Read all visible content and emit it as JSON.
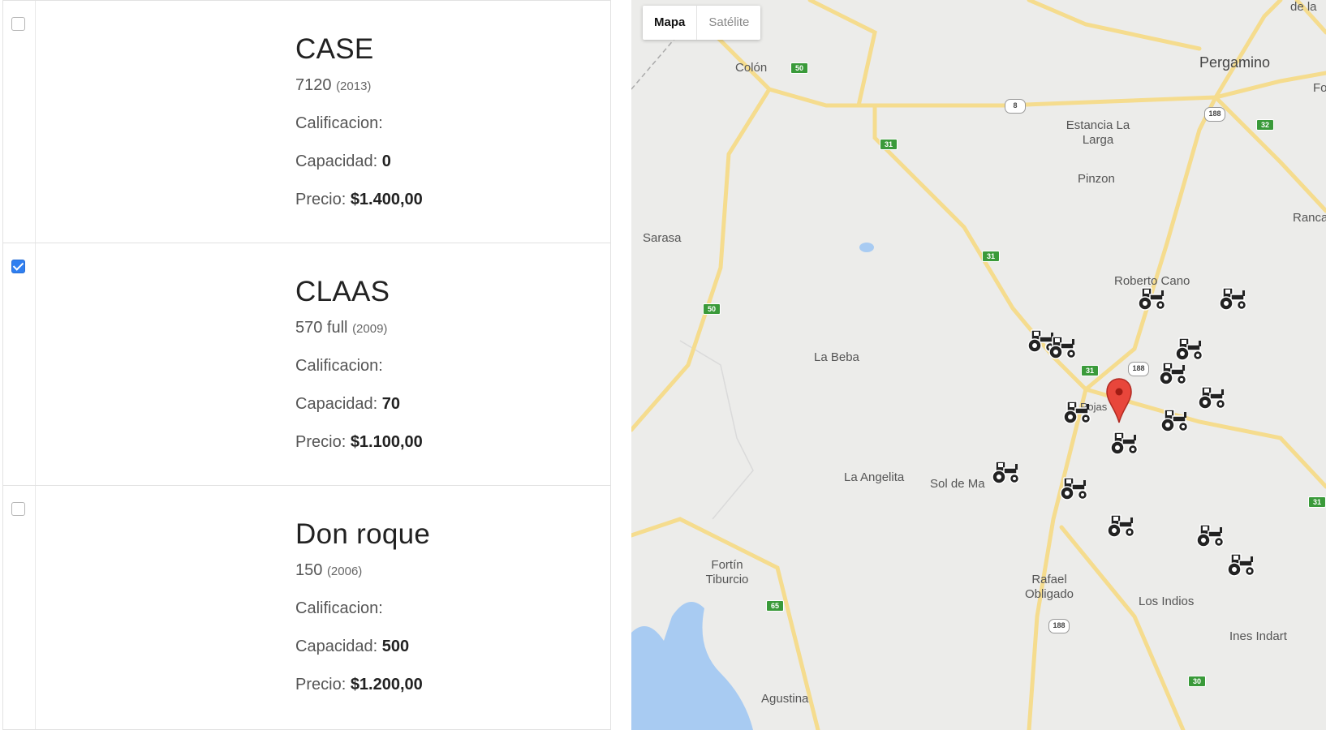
{
  "listings": [
    {
      "checked": false,
      "brand": "CASE",
      "model": "7120",
      "year": "(2013)",
      "rating_label": "Calificacion:",
      "rating_value": "",
      "capacity_label": "Capacidad:",
      "capacity_value": "0",
      "price_label": "Precio:",
      "price_value": "$1.400,00"
    },
    {
      "checked": true,
      "brand": "CLAAS",
      "model": "570 full",
      "year": "(2009)",
      "rating_label": "Calificacion:",
      "rating_value": "",
      "capacity_label": "Capacidad:",
      "capacity_value": "70",
      "price_label": "Precio:",
      "price_value": "$1.100,00"
    },
    {
      "checked": false,
      "brand": "Don roque",
      "model": "150",
      "year": "(2006)",
      "rating_label": "Calificacion:",
      "rating_value": "",
      "capacity_label": "Capacidad:",
      "capacity_value": "500",
      "price_label": "Precio:",
      "price_value": "$1.200,00"
    }
  ],
  "map": {
    "map_type": {
      "map": "Mapa",
      "satellite": "Satélite",
      "selected": "Mapa"
    },
    "places": {
      "colon": "Colón",
      "pergamino": "Pergamino",
      "estancia": "Estancia La Larga",
      "pinzon": "Pinzon",
      "rancagua": "Rancag",
      "sarasa": "Sarasa",
      "roberto_cano": "Roberto Cano",
      "la_beba": "La Beba",
      "rojas": "Rojas",
      "la_angelita": "La Angelita",
      "sol_de_mayo": "Sol de Ma",
      "fortin": "Fortín Tiburcio",
      "rafael": "Rafael Obligado",
      "los_indios": "Los Indios",
      "ines_indart": "Ines Indart",
      "agustina": "Agustina",
      "top_right": "de la",
      "fo": "Fo"
    },
    "route_shields": {
      "r50a": "50",
      "r8": "8",
      "r188a": "188",
      "r32": "32",
      "r31a": "31",
      "r31b": "31",
      "r50b": "50",
      "r31c": "31",
      "r188b": "188",
      "r65": "65",
      "r188c": "188",
      "r30": "30",
      "r31d": "31"
    },
    "marker_icons": [
      "tractor-icon",
      "map-pin-icon"
    ],
    "colors": {
      "road": "#f5dc8e",
      "water": "#a8cbf2",
      "background": "#ececea",
      "pin": "#e8463b"
    }
  }
}
